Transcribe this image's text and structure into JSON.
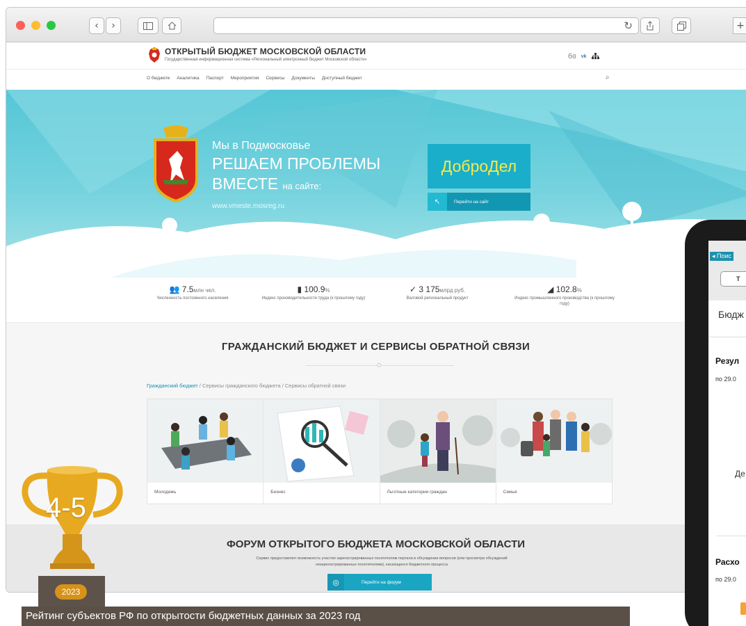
{
  "browser": {
    "colors": {
      "close": "#fe5f57",
      "minimize": "#febc2e",
      "zoom": "#28c840"
    },
    "url": ""
  },
  "site": {
    "title": "ОТКРЫТЫЙ БЮДЖЕТ МОСКОВСКОЙ ОБЛАСТИ",
    "subtitle": "Государственная информационная система «Региональный электронный бюджет Московской области»",
    "nav": [
      "О бюджете",
      "Аналитика",
      "Паспорт",
      "Мероприятия",
      "Сервисы",
      "Документы",
      "Доступный бюджет"
    ]
  },
  "banner": {
    "line1": "Мы в Подмосковье",
    "line2": "РЕШАЕМ ПРОБЛЕМЫ",
    "line3_big": "ВМЕСТЕ",
    "line3_small": "на сайте:",
    "url": "www.vmeste.mosreg.ru",
    "dobrodel": "ДоброДел",
    "go_site": "Перейти на сайт"
  },
  "stats": [
    {
      "icon": "people-icon",
      "value": "7.5",
      "unit": "млн чел.",
      "label": "Численность постоянного населения"
    },
    {
      "icon": "bar-chart-icon",
      "value": "100.9",
      "unit": "%",
      "label": "Индекс производительности труда (к прошлому году)"
    },
    {
      "icon": "check-icon",
      "value": "3 175",
      "unit": "млрд руб.",
      "label": "Валовой региональный продукт"
    },
    {
      "icon": "area-chart-icon",
      "value": "102.8",
      "unit": "%",
      "label": "Индекс промышленного производства (к прошлому году)"
    }
  ],
  "civic": {
    "title": "ГРАЖДАНСКИЙ БЮДЖЕТ И СЕРВИСЫ ОБРАТНОЙ СВЯЗИ",
    "breadcrumb": [
      "Гражданский бюджет",
      "Сервисы гражданского бюджета",
      "Сервисы обратной связи"
    ],
    "cards": [
      "Молодежь",
      "Бизнес",
      "Льготные категории граждан",
      "Семья"
    ]
  },
  "forum": {
    "title": "ФОРУМ ОТКРЫТОГО БЮДЖЕТА МОСКОВСКОЙ ОБЛАСТИ",
    "description": "Сервис предоставляет возможность участия зарегистрированных посетителям портала в обсуждении вопросов (или просмотра обсуждений незарегистрированных посетителями), касающихся бюджетного процесса",
    "button": "Перейти на форум"
  },
  "phone": {
    "back": "◂ Поис",
    "tab": "Т",
    "heading": "Бюдж",
    "section1": "Резул",
    "date1": "по 29.0",
    "fragment": "Де",
    "section2": "Расхо",
    "date2": "по 29.0"
  },
  "award": {
    "rank": "4-5",
    "year": "2023",
    "caption": "Рейтинг субъектов РФ по открытости бюджетных данных за 2023 год"
  }
}
